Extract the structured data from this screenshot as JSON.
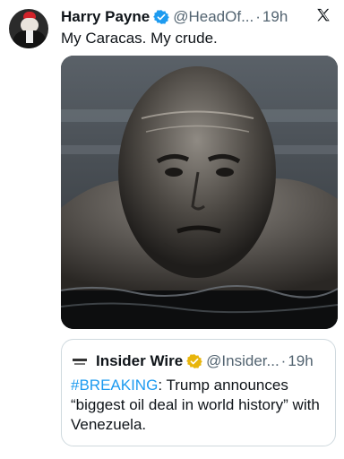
{
  "tweet": {
    "author_name": "Harry Payne",
    "handle": "@HeadOf...",
    "separator": "·",
    "time": "19h",
    "text": "My Caracas. My crude.",
    "verified_color": "#1d9bf0",
    "avatar_icon": "maga-hat-avatar",
    "platform_icon": "x-logo-icon"
  },
  "quote": {
    "author_name": "Insider Wire",
    "handle": "@Insider...",
    "separator": "·",
    "time": "19h",
    "verified_color": "#e8b50b",
    "hashtag": "#BREAKING",
    "text_rest": ": Trump announces “biggest oil deal in world history” with Venezuela.",
    "logo_icon": "insider-wire-logo"
  },
  "media": {
    "description_icon": "oil-covered-bust-image"
  }
}
